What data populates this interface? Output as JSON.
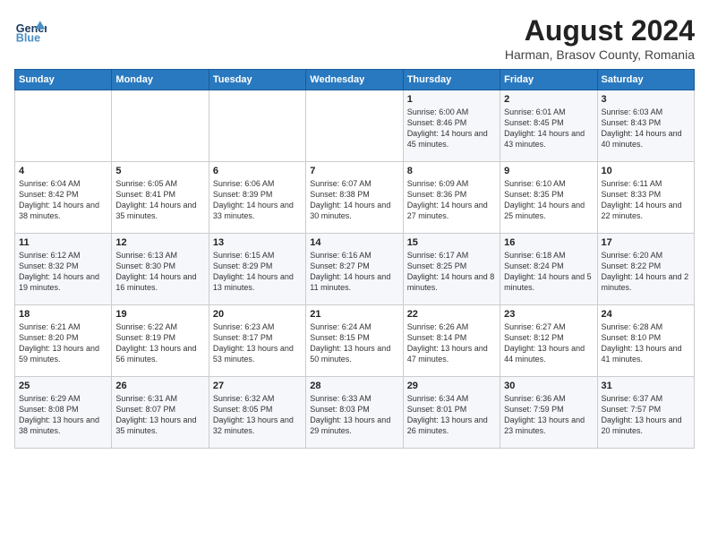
{
  "header": {
    "logo_line1": "General",
    "logo_line2": "Blue",
    "main_title": "August 2024",
    "subtitle": "Harman, Brasov County, Romania"
  },
  "days_of_week": [
    "Sunday",
    "Monday",
    "Tuesday",
    "Wednesday",
    "Thursday",
    "Friday",
    "Saturday"
  ],
  "weeks": [
    [
      {
        "day": "",
        "content": ""
      },
      {
        "day": "",
        "content": ""
      },
      {
        "day": "",
        "content": ""
      },
      {
        "day": "",
        "content": ""
      },
      {
        "day": "1",
        "content": "Sunrise: 6:00 AM\nSunset: 8:46 PM\nDaylight: 14 hours\nand 45 minutes."
      },
      {
        "day": "2",
        "content": "Sunrise: 6:01 AM\nSunset: 8:45 PM\nDaylight: 14 hours\nand 43 minutes."
      },
      {
        "day": "3",
        "content": "Sunrise: 6:03 AM\nSunset: 8:43 PM\nDaylight: 14 hours\nand 40 minutes."
      }
    ],
    [
      {
        "day": "4",
        "content": "Sunrise: 6:04 AM\nSunset: 8:42 PM\nDaylight: 14 hours\nand 38 minutes."
      },
      {
        "day": "5",
        "content": "Sunrise: 6:05 AM\nSunset: 8:41 PM\nDaylight: 14 hours\nand 35 minutes."
      },
      {
        "day": "6",
        "content": "Sunrise: 6:06 AM\nSunset: 8:39 PM\nDaylight: 14 hours\nand 33 minutes."
      },
      {
        "day": "7",
        "content": "Sunrise: 6:07 AM\nSunset: 8:38 PM\nDaylight: 14 hours\nand 30 minutes."
      },
      {
        "day": "8",
        "content": "Sunrise: 6:09 AM\nSunset: 8:36 PM\nDaylight: 14 hours\nand 27 minutes."
      },
      {
        "day": "9",
        "content": "Sunrise: 6:10 AM\nSunset: 8:35 PM\nDaylight: 14 hours\nand 25 minutes."
      },
      {
        "day": "10",
        "content": "Sunrise: 6:11 AM\nSunset: 8:33 PM\nDaylight: 14 hours\nand 22 minutes."
      }
    ],
    [
      {
        "day": "11",
        "content": "Sunrise: 6:12 AM\nSunset: 8:32 PM\nDaylight: 14 hours\nand 19 minutes."
      },
      {
        "day": "12",
        "content": "Sunrise: 6:13 AM\nSunset: 8:30 PM\nDaylight: 14 hours\nand 16 minutes."
      },
      {
        "day": "13",
        "content": "Sunrise: 6:15 AM\nSunset: 8:29 PM\nDaylight: 14 hours\nand 13 minutes."
      },
      {
        "day": "14",
        "content": "Sunrise: 6:16 AM\nSunset: 8:27 PM\nDaylight: 14 hours\nand 11 minutes."
      },
      {
        "day": "15",
        "content": "Sunrise: 6:17 AM\nSunset: 8:25 PM\nDaylight: 14 hours\nand 8 minutes."
      },
      {
        "day": "16",
        "content": "Sunrise: 6:18 AM\nSunset: 8:24 PM\nDaylight: 14 hours\nand 5 minutes."
      },
      {
        "day": "17",
        "content": "Sunrise: 6:20 AM\nSunset: 8:22 PM\nDaylight: 14 hours\nand 2 minutes."
      }
    ],
    [
      {
        "day": "18",
        "content": "Sunrise: 6:21 AM\nSunset: 8:20 PM\nDaylight: 13 hours\nand 59 minutes."
      },
      {
        "day": "19",
        "content": "Sunrise: 6:22 AM\nSunset: 8:19 PM\nDaylight: 13 hours\nand 56 minutes."
      },
      {
        "day": "20",
        "content": "Sunrise: 6:23 AM\nSunset: 8:17 PM\nDaylight: 13 hours\nand 53 minutes."
      },
      {
        "day": "21",
        "content": "Sunrise: 6:24 AM\nSunset: 8:15 PM\nDaylight: 13 hours\nand 50 minutes."
      },
      {
        "day": "22",
        "content": "Sunrise: 6:26 AM\nSunset: 8:14 PM\nDaylight: 13 hours\nand 47 minutes."
      },
      {
        "day": "23",
        "content": "Sunrise: 6:27 AM\nSunset: 8:12 PM\nDaylight: 13 hours\nand 44 minutes."
      },
      {
        "day": "24",
        "content": "Sunrise: 6:28 AM\nSunset: 8:10 PM\nDaylight: 13 hours\nand 41 minutes."
      }
    ],
    [
      {
        "day": "25",
        "content": "Sunrise: 6:29 AM\nSunset: 8:08 PM\nDaylight: 13 hours\nand 38 minutes."
      },
      {
        "day": "26",
        "content": "Sunrise: 6:31 AM\nSunset: 8:07 PM\nDaylight: 13 hours\nand 35 minutes."
      },
      {
        "day": "27",
        "content": "Sunrise: 6:32 AM\nSunset: 8:05 PM\nDaylight: 13 hours\nand 32 minutes."
      },
      {
        "day": "28",
        "content": "Sunrise: 6:33 AM\nSunset: 8:03 PM\nDaylight: 13 hours\nand 29 minutes."
      },
      {
        "day": "29",
        "content": "Sunrise: 6:34 AM\nSunset: 8:01 PM\nDaylight: 13 hours\nand 26 minutes."
      },
      {
        "day": "30",
        "content": "Sunrise: 6:36 AM\nSunset: 7:59 PM\nDaylight: 13 hours\nand 23 minutes."
      },
      {
        "day": "31",
        "content": "Sunrise: 6:37 AM\nSunset: 7:57 PM\nDaylight: 13 hours\nand 20 minutes."
      }
    ]
  ]
}
